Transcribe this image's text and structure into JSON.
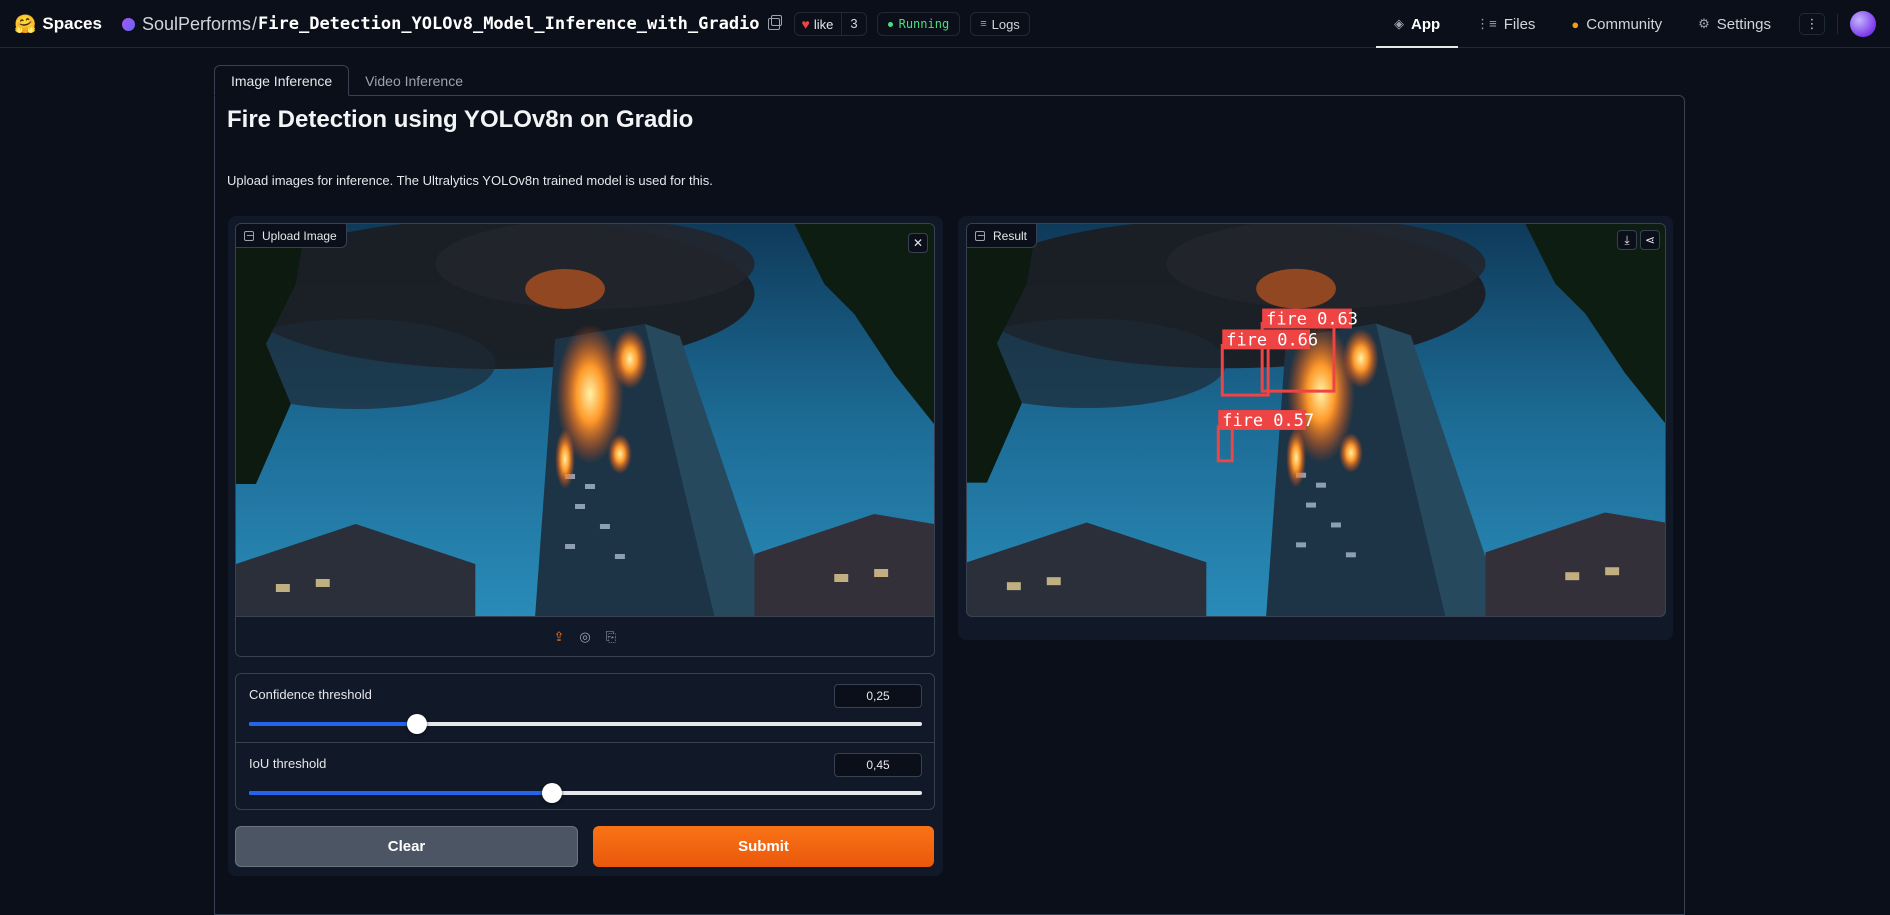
{
  "topbar": {
    "spaces_label": "Spaces",
    "owner": "SoulPerforms",
    "separator": "/",
    "repo": "Fire_Detection_YOLOv8_Model_Inference_with_Gradio",
    "like_label": "like",
    "like_count": "3",
    "status": "Running",
    "logs_label": "Logs",
    "nav": [
      {
        "label": "App",
        "icon": "cube-icon",
        "active": true
      },
      {
        "label": "Files",
        "icon": "files-icon",
        "active": false
      },
      {
        "label": "Community",
        "icon": "community-icon",
        "active": false
      },
      {
        "label": "Settings",
        "icon": "gear-icon",
        "active": false
      }
    ]
  },
  "tabs": [
    {
      "label": "Image Inference",
      "active": true
    },
    {
      "label": "Video Inference",
      "active": false
    }
  ],
  "page": {
    "title": "Fire Detection using YOLOv8n on Gradio",
    "description": "Upload images for inference. The Ultralytics YOLOv8n trained model is used for this."
  },
  "input_image": {
    "label": "Upload Image"
  },
  "output_image": {
    "label": "Result",
    "detections": [
      {
        "label": "fire 0.63"
      },
      {
        "label": "fire 0.66"
      },
      {
        "label": "fire 0.57"
      }
    ]
  },
  "sliders": {
    "confidence": {
      "label": "Confidence threshold",
      "value": "0,25",
      "fraction": 0.25
    },
    "iou": {
      "label": "IoU threshold",
      "value": "0,45",
      "fraction": 0.45
    }
  },
  "buttons": {
    "clear": "Clear",
    "submit": "Submit"
  },
  "colors": {
    "accent": "#f97316",
    "slider_fill": "#2563eb",
    "detection_box": "#ef4444",
    "status": "#4ade80"
  }
}
